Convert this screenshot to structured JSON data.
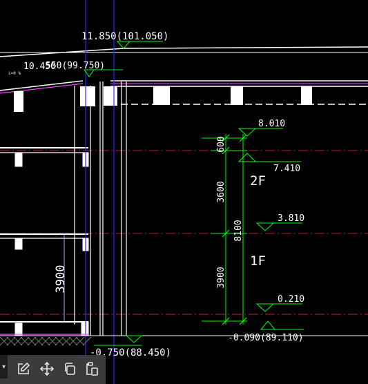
{
  "drawing": {
    "elevations": {
      "roof_top": "11.850(101.050)",
      "eave_overlap_a": "10.450",
      "eave_overlap_b": "550(99.750)",
      "floor2_top": "8.010",
      "floor2": "7.410",
      "floor1_mid": "3.810",
      "floor1_base": "0.210",
      "ground_right": "-0.090(89.110)",
      "ground_left": "-0.750(88.450)"
    },
    "floor_labels": {
      "second": "2F",
      "first": "1F"
    },
    "dimensions": {
      "d600": "600",
      "d3600": "3600",
      "d3900": "3900",
      "d8100": "8100",
      "left_3900": "3900"
    },
    "slope_note": "i=0 %"
  },
  "toolbar": {
    "collapse": "▾",
    "buttons": [
      {
        "name": "edit",
        "icon": "edit-icon"
      },
      {
        "name": "move",
        "icon": "move-icon"
      },
      {
        "name": "copy",
        "icon": "copy-icon"
      },
      {
        "name": "paste",
        "icon": "paste-icon"
      }
    ]
  },
  "colors": {
    "background": "#000000",
    "annotation": "#00ff00",
    "structure": "#ffffff",
    "axis": "#2a2aff",
    "floor_line": "#cc2244",
    "ground": "#ff44ff"
  }
}
